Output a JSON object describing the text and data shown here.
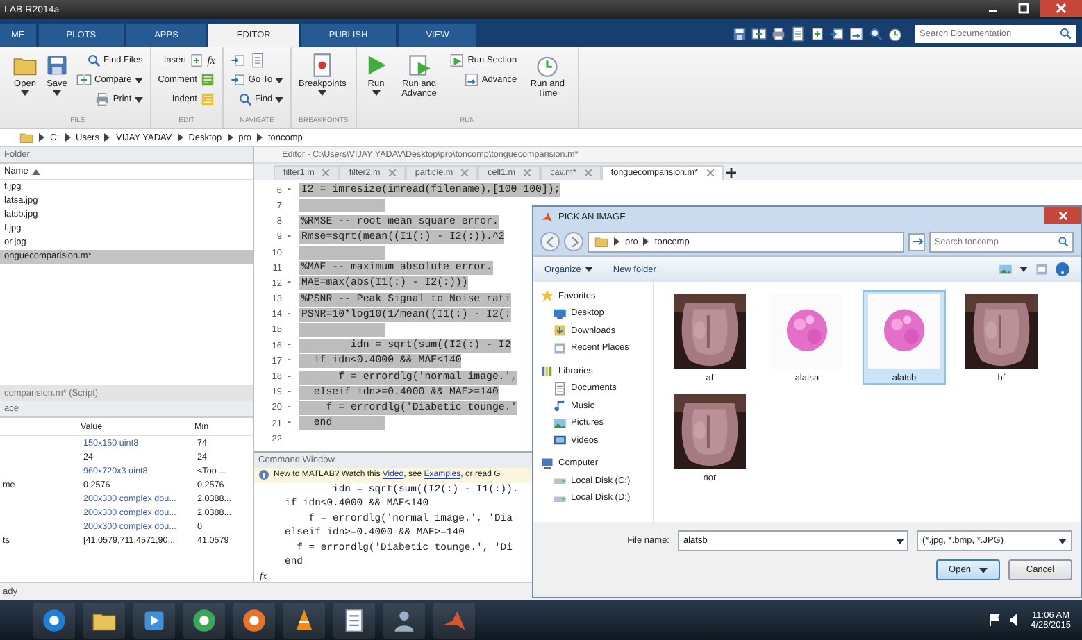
{
  "window": {
    "title": "LAB R2014a"
  },
  "tabs": [
    {
      "label": "ME",
      "selected": false
    },
    {
      "label": "PLOTS",
      "selected": false
    },
    {
      "label": "APPS",
      "selected": false
    },
    {
      "label": "EDITOR",
      "selected": true
    },
    {
      "label": "PUBLISH",
      "selected": false
    },
    {
      "label": "VIEW",
      "selected": false
    }
  ],
  "search": {
    "placeholder": "Search Documentation"
  },
  "ribbon": [
    {
      "label": "FILE",
      "items": [
        {
          "kind": "large",
          "label": "Open",
          "dropdown": true
        },
        {
          "kind": "large",
          "label": "Save",
          "dropdown": true
        },
        {
          "kind": "stack",
          "items": [
            {
              "label": "Find Files",
              "dropdown": false
            },
            {
              "label": "Compare",
              "dropdown": true
            },
            {
              "label": "Print",
              "dropdown": true
            }
          ]
        }
      ]
    },
    {
      "label": "EDIT",
      "items": [
        {
          "kind": "stack",
          "items": [
            {
              "label": "Insert",
              "dropdown": false,
              "glyph": "fx"
            },
            {
              "label": "Comment",
              "dropdown": false
            },
            {
              "label": "Indent",
              "dropdown": false
            }
          ]
        }
      ]
    },
    {
      "label": "NAVIGATE",
      "items": [
        {
          "kind": "stack",
          "items": [
            {
              "label": "Go To",
              "dropdown": true
            },
            {
              "label": "Find",
              "dropdown": true
            }
          ]
        }
      ]
    },
    {
      "label": "BREAKPOINTS",
      "items": [
        {
          "kind": "large",
          "label": "Breakpoints",
          "dropdown": true
        }
      ]
    },
    {
      "label": "RUN",
      "items": [
        {
          "kind": "large",
          "label": "Run",
          "dropdown": true
        },
        {
          "kind": "large",
          "label": "Run and Advance",
          "dropdown": false
        },
        {
          "kind": "stack",
          "items": [
            {
              "label": "Run Section",
              "dropdown": false
            },
            {
              "label": "Advance",
              "dropdown": false
            }
          ]
        },
        {
          "kind": "large",
          "label": "Run and Time",
          "dropdown": false
        }
      ]
    }
  ],
  "address": [
    "C:",
    "Users",
    "VIJAY YADAV",
    "Desktop",
    "pro",
    "toncomp"
  ],
  "folder": {
    "title": "Folder",
    "column": "Name",
    "files": [
      {
        "name": "f.jpg",
        "selected": false
      },
      {
        "name": "latsa.jpg",
        "selected": false
      },
      {
        "name": "latsb.jpg",
        "selected": false
      },
      {
        "name": "f.jpg",
        "selected": false
      },
      {
        "name": "or.jpg",
        "selected": false
      },
      {
        "name": "onguecomparision.m*",
        "selected": true
      }
    ],
    "details": "comparision.m* (Script)"
  },
  "workspace": {
    "title": "ace",
    "columns": [
      "Value",
      "Min"
    ],
    "rows": [
      {
        "value": "150x150 uint8",
        "min": "74",
        "kind": "array"
      },
      {
        "value": "24",
        "min": "24",
        "kind": "scalar"
      },
      {
        "value": "960x720x3 uint8",
        "min": "<Too ...",
        "kind": "array"
      },
      {
        "name": "me",
        "value": "0.2576",
        "min": "0.2576",
        "kind": "scalar"
      },
      {
        "value": "200x300 complex dou...",
        "min": "2.0388...",
        "kind": "array"
      },
      {
        "value": "200x300 complex dou...",
        "min": "2.0388...",
        "kind": "array"
      },
      {
        "value": "200x300 complex dou...",
        "min": "0",
        "kind": "array"
      },
      {
        "name": "ts",
        "value": "[41.0579,711.4571,90...",
        "min": "41.0579",
        "kind": "scalar"
      }
    ]
  },
  "editor": {
    "title": "Editor - C:\\Users\\VIJAY YADAV\\Desktop\\pro\\toncomp\\tonguecomparision.m*",
    "tabs": [
      {
        "label": "filter1.m",
        "selected": false
      },
      {
        "label": "filter2.m",
        "selected": false
      },
      {
        "label": "particle.m",
        "selected": false
      },
      {
        "label": "cell1.m",
        "selected": false
      },
      {
        "label": "cav.m*",
        "selected": false
      },
      {
        "label": "tonguecomparision.m*",
        "selected": true
      }
    ],
    "lines": [
      {
        "number": "6",
        "marker": "-",
        "code": "I2 = imresize(imread(filename),[100 100]);",
        "selected": true
      },
      {
        "number": "7",
        "selected": true
      },
      {
        "number": "8",
        "code": "%RMSE -- root mean square error.",
        "selected": true
      },
      {
        "number": "9",
        "marker": "-",
        "code": "Rmse=sqrt(mean((I1(:) - I2(:)).^2",
        "selected": true
      },
      {
        "number": "10",
        "selected": true
      },
      {
        "number": "11",
        "code": "%MAE -- maximum absolute error.",
        "selected": true
      },
      {
        "number": "12",
        "marker": "-",
        "code": "MAE=max(abs(I1(:) - I2(:)))",
        "selected": true
      },
      {
        "number": "13",
        "code": "%PSNR -- Peak Signal to Noise rati",
        "selected": true
      },
      {
        "number": "14",
        "marker": "-",
        "code": "PSNR=10*log10(1/mean((I1(:) - I2(:",
        "selected": true
      },
      {
        "number": "15",
        "selected": true
      },
      {
        "number": "16",
        "marker": "-",
        "code": "        idn = sqrt(sum((I2(:) - I2",
        "selected": true
      },
      {
        "number": "17",
        "marker": "-",
        "code": "  if idn<0.4000 && MAE<140",
        "selected": true
      },
      {
        "number": "18",
        "marker": "-",
        "code": "      f = errordlg('normal image.',",
        "selected": true
      },
      {
        "number": "19",
        "marker": "-",
        "code": "  elseif idn>=0.4000 && MAE>=140",
        "selected": true
      },
      {
        "number": "20",
        "marker": "-",
        "code": "    f = errordlg('Diabetic tounge.'",
        "selected": true
      },
      {
        "number": "21",
        "marker": "-",
        "code": "  end",
        "selected": true
      },
      {
        "number": "22",
        "selected": false
      }
    ]
  },
  "command_window": {
    "title": "Command Window",
    "info": [
      {
        "text": "New to MATLAB? Watch this ",
        "link": false
      },
      {
        "text": "Video",
        "link": true
      },
      {
        "text": ", see ",
        "link": false
      },
      {
        "text": "Examples",
        "link": true
      },
      {
        "text": ", or read G",
        "link": false
      }
    ],
    "lines": [
      "        idn = sqrt(sum((I2(:) - I1(:)).",
      "if idn<0.4000 && MAE<140",
      "    f = errordlg('normal image.', 'Dia",
      "elseif idn>=0.4000 && MAE>=140",
      "  f = errordlg('Diabetic tounge.', 'Di",
      "end"
    ],
    "prompt": "fx"
  },
  "status_bar": "ady",
  "dialog": {
    "title": "PICK AN IMAGE",
    "path": [
      "pro",
      "toncomp"
    ],
    "search_placeholder": "Search toncomp",
    "toolbar": [
      {
        "label": "Organize",
        "dropdown": true
      },
      {
        "label": "New folder",
        "dropdown": false
      }
    ],
    "nav": [
      {
        "label": "Favorites",
        "kind": "group"
      },
      {
        "label": "Desktop",
        "kind": "item"
      },
      {
        "label": "Downloads",
        "kind": "item"
      },
      {
        "label": "Recent Places",
        "kind": "item"
      },
      {
        "label": "Libraries",
        "kind": "group"
      },
      {
        "label": "Documents",
        "kind": "item"
      },
      {
        "label": "Music",
        "kind": "item"
      },
      {
        "label": "Pictures",
        "kind": "item"
      },
      {
        "label": "Videos",
        "kind": "item"
      },
      {
        "label": "Computer",
        "kind": "group"
      },
      {
        "label": "Local Disk (C:)",
        "kind": "item"
      },
      {
        "label": "Local Disk (D:)",
        "kind": "item"
      }
    ],
    "files": [
      {
        "name": "af",
        "selected": false
      },
      {
        "name": "alatsa",
        "selected": false
      },
      {
        "name": "alatsb",
        "selected": true
      },
      {
        "name": "bf",
        "selected": false
      },
      {
        "name": "nor",
        "selected": false
      }
    ],
    "file_name_label": "File name:",
    "file_name": "alatsb",
    "filter": "(*.jpg, *.bmp, *.JPG)",
    "buttons": [
      "Open",
      "Cancel"
    ]
  },
  "taskbar": {
    "time": "11:06 AM",
    "date": "4/28/2015"
  }
}
